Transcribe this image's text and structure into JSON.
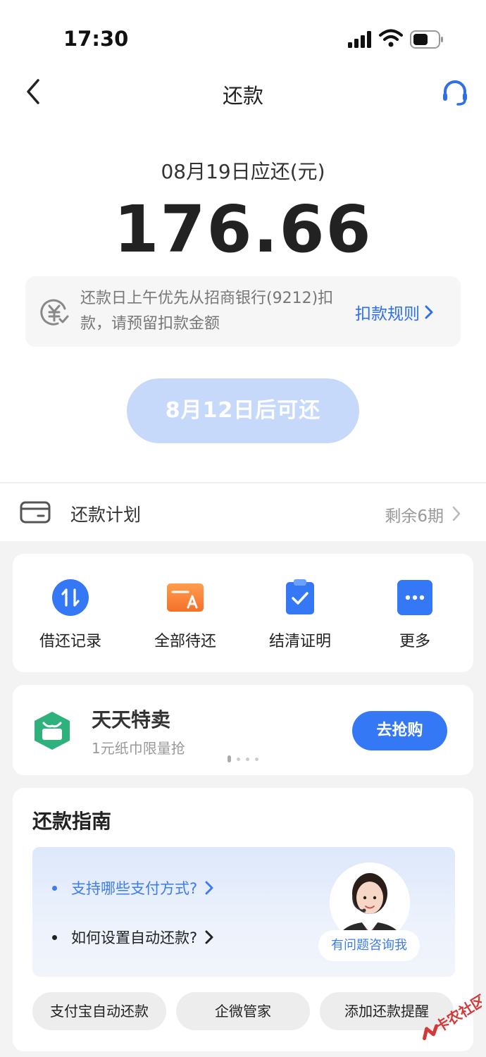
{
  "status_bar": {
    "time": "17:30"
  },
  "nav": {
    "title": "还款"
  },
  "due": {
    "label": "08月19日应还(元)",
    "amount": "176.66"
  },
  "notice": {
    "text": "还款日上午优先从招商银行(9212)扣款，请预留扣款金额",
    "link_label": "扣款规则"
  },
  "repay_button": {
    "label": "8月12日后可还"
  },
  "plan": {
    "label": "还款计划",
    "remaining": "剩余6期"
  },
  "quick_actions": [
    {
      "label": "借还记录",
      "icon": "arrows-icon"
    },
    {
      "label": "全部待还",
      "icon": "bill-icon"
    },
    {
      "label": "结清证明",
      "icon": "clipboard-check-icon"
    },
    {
      "label": "更多",
      "icon": "more-icon"
    }
  ],
  "promo": {
    "title": "天天特卖",
    "subtitle": "1元纸巾限量抢",
    "button": "去抢购"
  },
  "guide": {
    "title": "还款指南",
    "faq": [
      {
        "text": "支持哪些支付方式?"
      },
      {
        "text": "如何设置自动还款?"
      }
    ],
    "ask_label": "有问题咨询我",
    "chips": [
      "支付宝自动还款",
      "企微管家",
      "添加还款提醒"
    ]
  },
  "watermark": {
    "text": "卡农社区"
  },
  "colors": {
    "accent": "#3478f6",
    "button_disabled": "#c6d9fb",
    "background": "#f3f3f3"
  }
}
